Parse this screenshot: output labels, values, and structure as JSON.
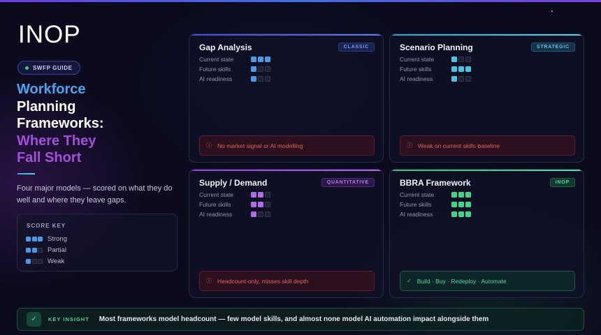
{
  "brand": {
    "logo": "INOP"
  },
  "badge": {
    "label": "SWFP GUIDE"
  },
  "title": {
    "line1": "Workforce",
    "line2": "Planning",
    "line3": "Frameworks:",
    "line4": "Where They",
    "line5": "Fall Short"
  },
  "description": "Four major models — scored on what they do well and where they leave gaps.",
  "score_key": {
    "title": "SCORE KEY",
    "items": [
      {
        "label": "Strong",
        "filled": 3
      },
      {
        "label": "Partial",
        "filled": 2
      },
      {
        "label": "Weak",
        "filled": 1
      }
    ]
  },
  "metric_labels": [
    "Current state",
    "Future skills",
    "AI readiness"
  ],
  "cards": [
    {
      "title": "Gap Analysis",
      "tag": "CLASSIC",
      "accent": "#4a6cf0",
      "scores": [
        3,
        1,
        1
      ],
      "note": "No market signal or AI modelling",
      "note_type": "bad"
    },
    {
      "title": "Scenario Planning",
      "tag": "STRATEGIC",
      "accent": "#3bb3d8",
      "scores": [
        1,
        3,
        1
      ],
      "note": "Weak on current skills baseline",
      "note_type": "bad"
    },
    {
      "title": "Supply / Demand",
      "tag": "QUANTITATIVE",
      "accent": "#a455e0",
      "scores": [
        2,
        2,
        1
      ],
      "note": "Headcount-only, misses skill depth",
      "note_type": "bad"
    },
    {
      "title": "BBRA Framework",
      "tag": "INOP",
      "accent": "#34d07e",
      "scores": [
        3,
        3,
        3
      ],
      "note": "Build · Buy · Redeploy · Automate",
      "note_type": "good"
    }
  ],
  "insight": {
    "label": "KEY INSIGHT",
    "text": "Most frameworks model headcount — few model skills, and almost none model AI automation impact alongside them"
  },
  "colors": {
    "blue": "#4a9ae8",
    "cyan": "#49c4e0",
    "purple": "#b06be6",
    "green": "#3fd486"
  }
}
